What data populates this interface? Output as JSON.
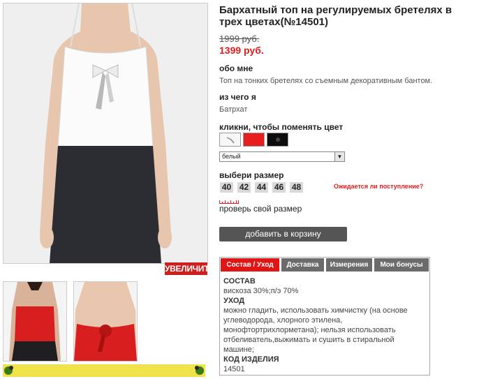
{
  "product": {
    "title": "Бархатный топ на регулируемых бретелях в трех цветах(№14501)",
    "old_price": "1999 руб.",
    "new_price": "1399 руб."
  },
  "gallery": {
    "zoom_label": "УВЕЛИЧИТЬ"
  },
  "about": {
    "heading": "обо мне",
    "text": "Топ на тонких бретелях со съемным декоративным бантом."
  },
  "material": {
    "heading": "из чего я",
    "text": "Батрхат"
  },
  "colors": {
    "heading": "кликни, чтобы поменять цвет",
    "swatches": [
      "white",
      "red",
      "black"
    ],
    "selected": "белый"
  },
  "sizes": {
    "heading": "выбери размер",
    "options": [
      "40",
      "42",
      "44",
      "46",
      "48"
    ],
    "waiting_link": "Ожидается ли поступление?",
    "check_link": "проверь свой размер"
  },
  "cart": {
    "button_label": "добавить в корзину"
  },
  "tabs": {
    "items": [
      "Состав / Уход",
      "Доставка",
      "Измерения",
      "Мои бонусы"
    ],
    "active": "Состав / Уход",
    "content": {
      "composition_heading": "СОСТАВ",
      "composition": "вискоза 30%;п/э 70%",
      "care_heading": "УХОД",
      "care": "можно гладить, использовать химчистку (на основе углеводорода, хлорного этилена, монофтортрихлорметана); нельзя использовать отбеливатель,выжимать и сушить в стиральной машине;",
      "code_heading": "КОД ИЗДЕЛИЯ",
      "code": "14501"
    }
  },
  "colors_hex": {
    "accent_red": "#e01515",
    "tab_gray": "#6b6b6b",
    "cart_button": "#555555",
    "bottom_bar": "#efe24a"
  }
}
